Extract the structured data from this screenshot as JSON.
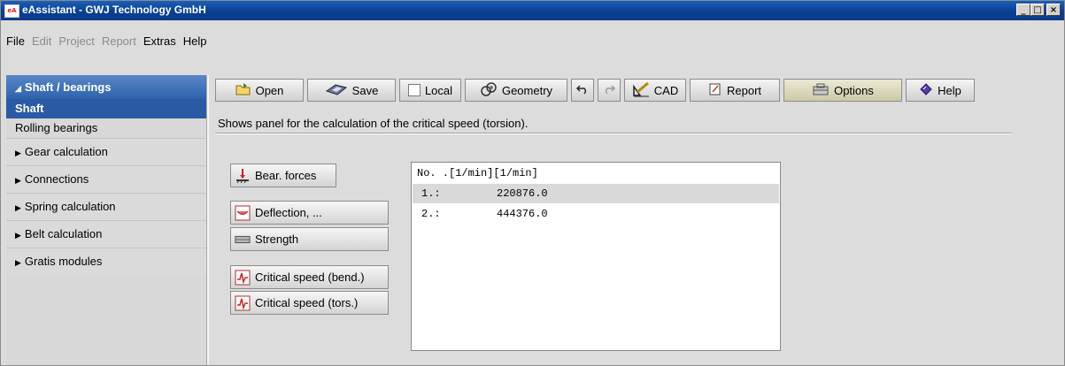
{
  "window": {
    "app_icon": "eA",
    "title": "eAssistant - GWJ Technology GmbH",
    "controls": [
      "_",
      "□",
      "×"
    ]
  },
  "menu": [
    {
      "label": "File",
      "enabled": true
    },
    {
      "label": "Edit",
      "enabled": false
    },
    {
      "label": "Project",
      "enabled": false
    },
    {
      "label": "Report",
      "enabled": false
    },
    {
      "label": "Extras",
      "enabled": true
    },
    {
      "label": "Help",
      "enabled": true
    }
  ],
  "sidebar": {
    "header": "Shaft / bearings",
    "subitems": [
      {
        "label": "Shaft",
        "selected": true
      },
      {
        "label": "Rolling bearings",
        "selected": false
      }
    ],
    "groups": [
      "Gear calculation",
      "Connections",
      "Spring calculation",
      "Belt calculation",
      "Gratis modules"
    ]
  },
  "toolbar": {
    "open": "Open",
    "save": "Save",
    "local": "Local",
    "geometry": "Geometry",
    "cad": "CAD",
    "report": "Report",
    "options": "Options",
    "help": "Help"
  },
  "info_text": "Shows panel for the calculation of the critical speed (torsion).",
  "calc_buttons": [
    "Bear. forces",
    "Deflection, ...",
    "Strength",
    "Critical speed (bend.)",
    "Critical speed (tors.)"
  ],
  "results": {
    "header": "No. .[1/min][1/min]",
    "rows": [
      {
        "no": "1.:",
        "value": "220876.0",
        "highlighted": true
      },
      {
        "no": "2.:",
        "value": "444376.0",
        "highlighted": false
      }
    ]
  },
  "colors": {
    "title_bar": "#0a3f93",
    "sidebar_header": "#3a6db5",
    "selected_item": "#2a5aa3"
  }
}
